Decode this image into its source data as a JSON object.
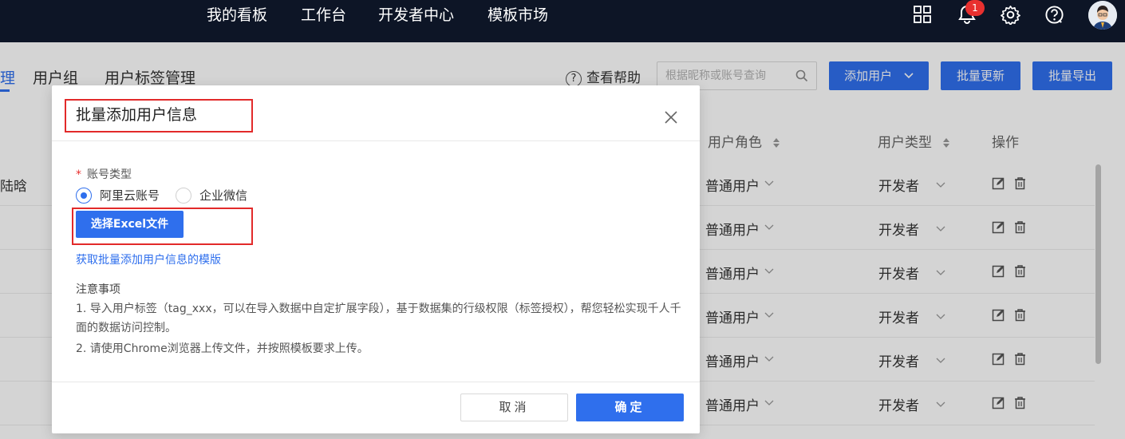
{
  "topnav": {
    "items": [
      "我的看板",
      "工作台",
      "开发者中心",
      "模板市场"
    ],
    "notification_count": "1"
  },
  "page": {
    "tabs": [
      "理",
      "用户组",
      "用户标签管理"
    ],
    "help_label": "查看帮助",
    "search_placeholder": "根据昵称或账号查询",
    "add_user_label": "添加用户",
    "batch_update_label": "批量更新",
    "batch_export_label": "批量导出",
    "columns": [
      "用户角色",
      "用户类型",
      "操作"
    ],
    "first_row_name": "陆晗",
    "rows": [
      {
        "role": "普通用户",
        "type": "开发者"
      },
      {
        "role": "普通用户",
        "type": "开发者"
      },
      {
        "role": "普通用户",
        "type": "开发者"
      },
      {
        "role": "普通用户",
        "type": "开发者"
      },
      {
        "role": "普通用户",
        "type": "开发者"
      },
      {
        "role": "普通用户",
        "type": "开发者"
      }
    ]
  },
  "modal": {
    "title": "批量添加用户信息",
    "account_type_label": "账号类型",
    "required_mark": "*",
    "radio_options": [
      {
        "label": "阿里云账号",
        "checked": true
      },
      {
        "label": "企业微信",
        "checked": false
      }
    ],
    "file_button_label": "选择Excel文件",
    "template_link": "获取批量添加用户信息的模版",
    "notes_title": "注意事项",
    "notes": [
      "1. 导入用户标签（tag_xxx，可以在导入数据中自定扩展字段），基于数据集的行级权限（标签授权），帮您轻松实现千人千面的数据访问控制。",
      "2. 请使用Chrome浏览器上传文件，并按照模板要求上传。"
    ],
    "cancel_label": "取消",
    "ok_label": "确定"
  },
  "colors": {
    "primary": "#2f6fed",
    "nav_background": "#0d1526",
    "highlight_border": "#e22a2a",
    "badge": "#e8302f"
  }
}
